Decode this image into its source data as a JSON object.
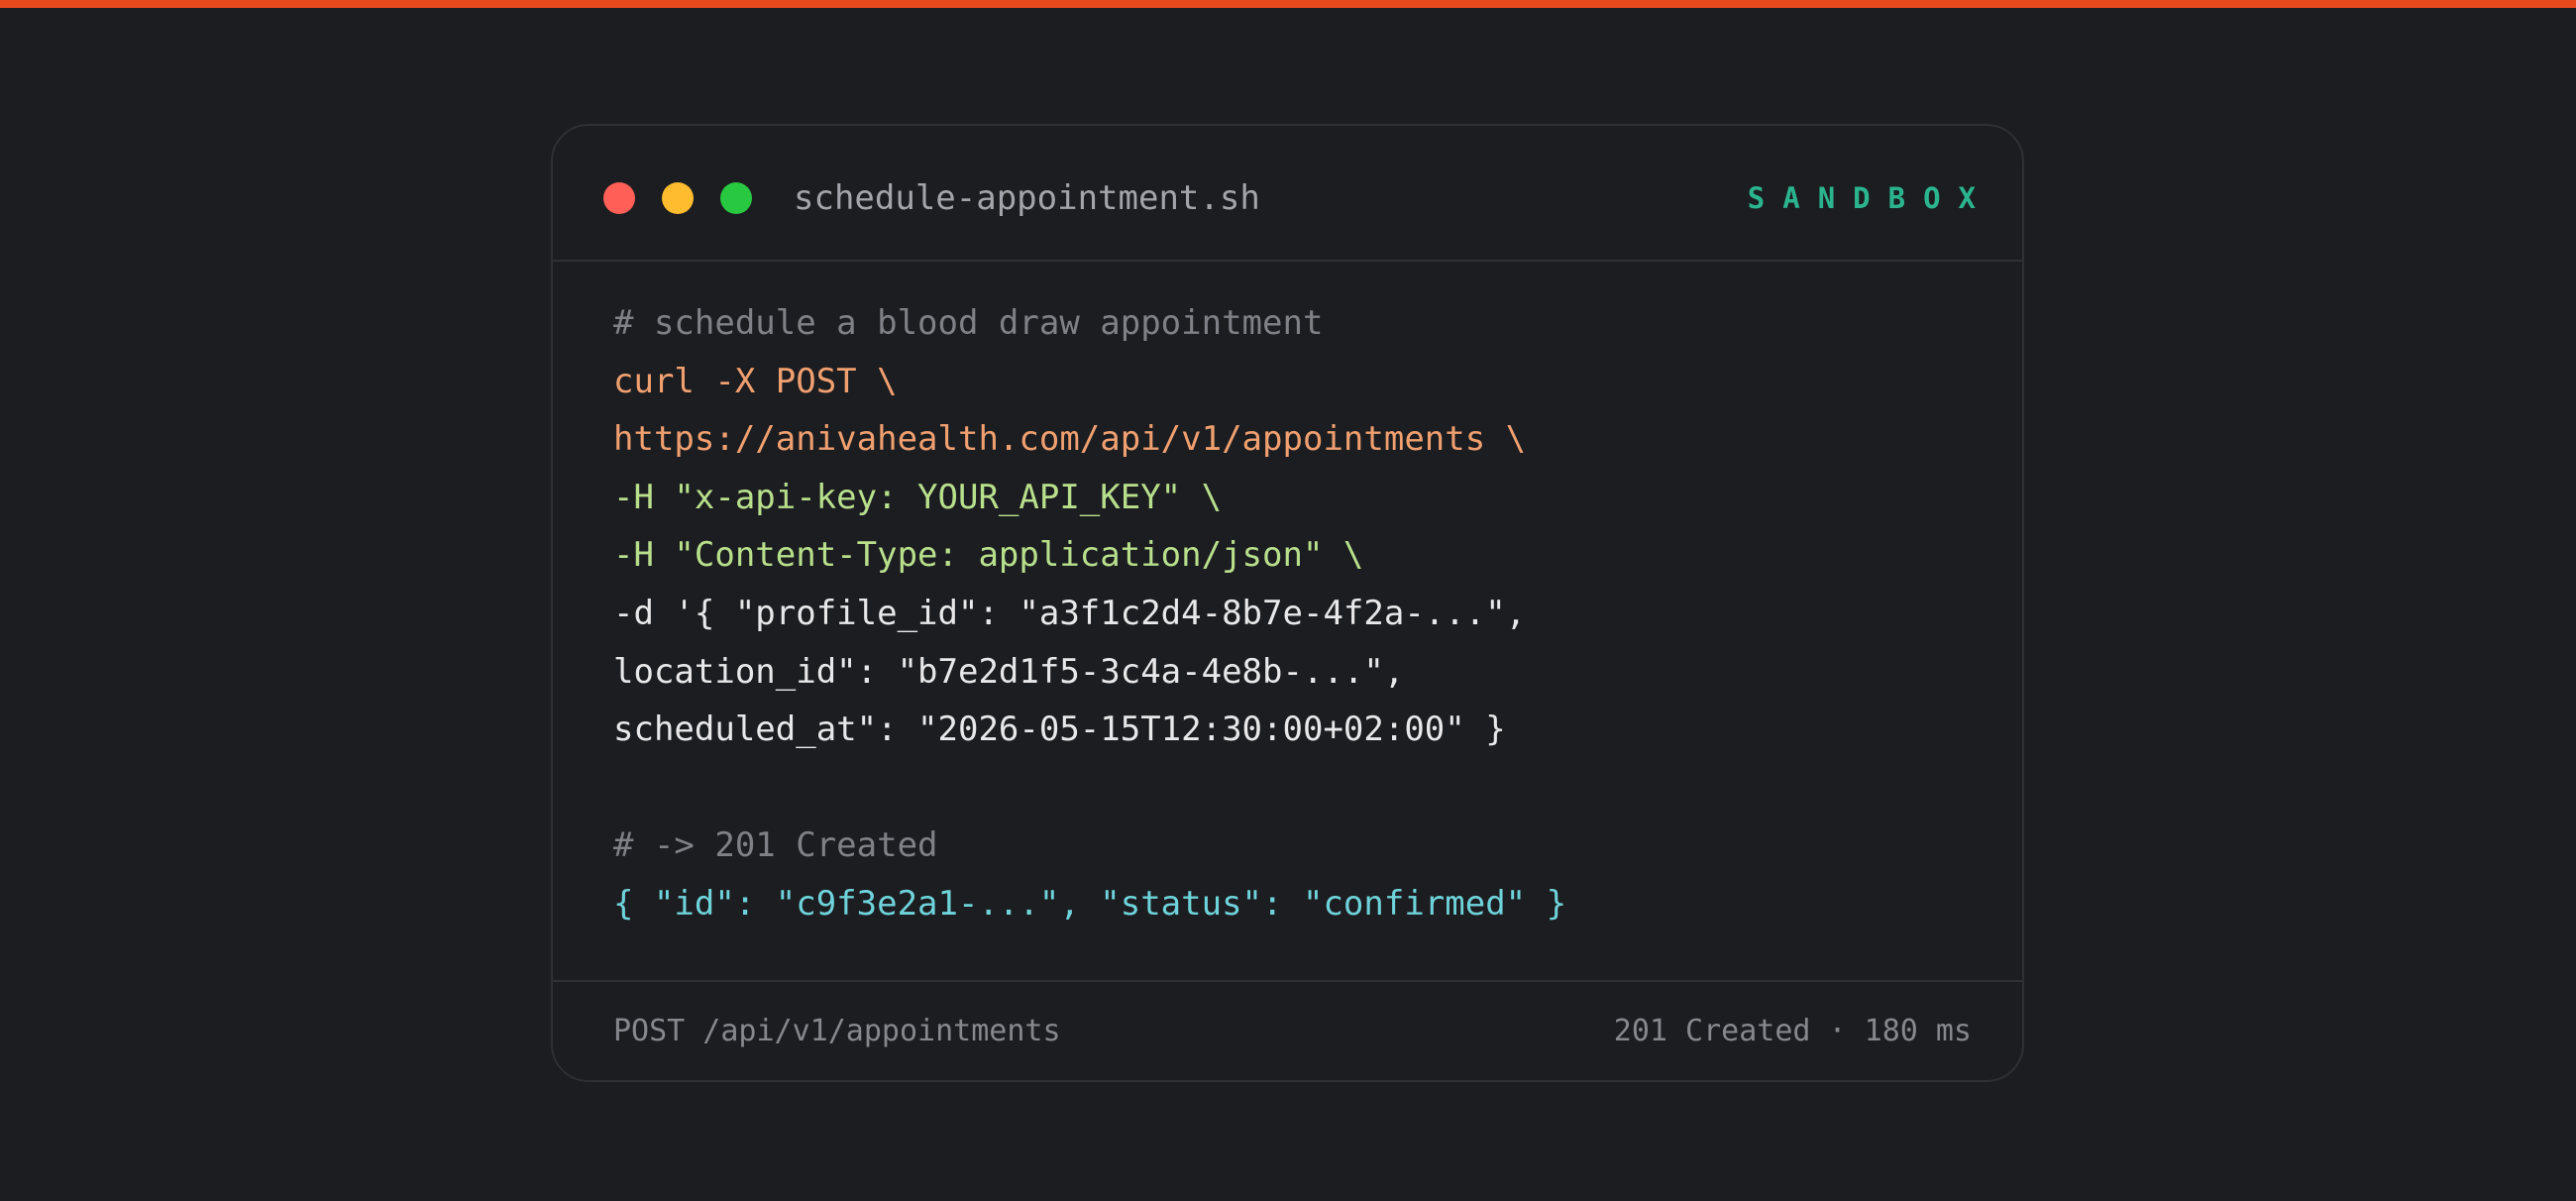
{
  "window": {
    "filename": "schedule-appointment.sh",
    "environment": "SANDBOX",
    "controls": [
      "close-dot",
      "minimize-dot",
      "maximize-dot"
    ]
  },
  "code": {
    "lines": [
      {
        "text": "# schedule a blood draw appointment",
        "kind": "comment"
      },
      {
        "text": "curl -X POST \\",
        "kind": "orange"
      },
      {
        "text": "https://anivahealth.com/api/v1/appointments \\",
        "kind": "orange"
      },
      {
        "text": "-H \"x-api-key: YOUR_API_KEY\" \\",
        "kind": "green"
      },
      {
        "text": "-H \"Content-Type: application/json\" \\",
        "kind": "green"
      },
      {
        "text": "-d '{ \"profile_id\": \"a3f1c2d4-8b7e-4f2a-...\",",
        "kind": "white"
      },
      {
        "text": "location_id\": \"b7e2d1f5-3c4a-4e8b-...\",",
        "kind": "white"
      },
      {
        "text": "scheduled_at\": \"2026-05-15T12:30:00+02:00\" }",
        "kind": "white"
      },
      {
        "text": "",
        "kind": "white"
      },
      {
        "text": "# -> 201 Created",
        "kind": "comment"
      },
      {
        "text": "{ \"id\": \"c9f3e2a1-...\", \"status\": \"confirmed\" }",
        "kind": "cyan"
      }
    ]
  },
  "footer": {
    "endpoint": "POST /api/v1/appointments",
    "status": "201 Created · 180 ms"
  },
  "colors": {
    "accent_bar": "#e8491d",
    "background": "#1c1d20",
    "sandbox": "#2bb58f",
    "close": "#ff5f57",
    "minimize": "#febc2e",
    "maximize": "#28c840"
  }
}
